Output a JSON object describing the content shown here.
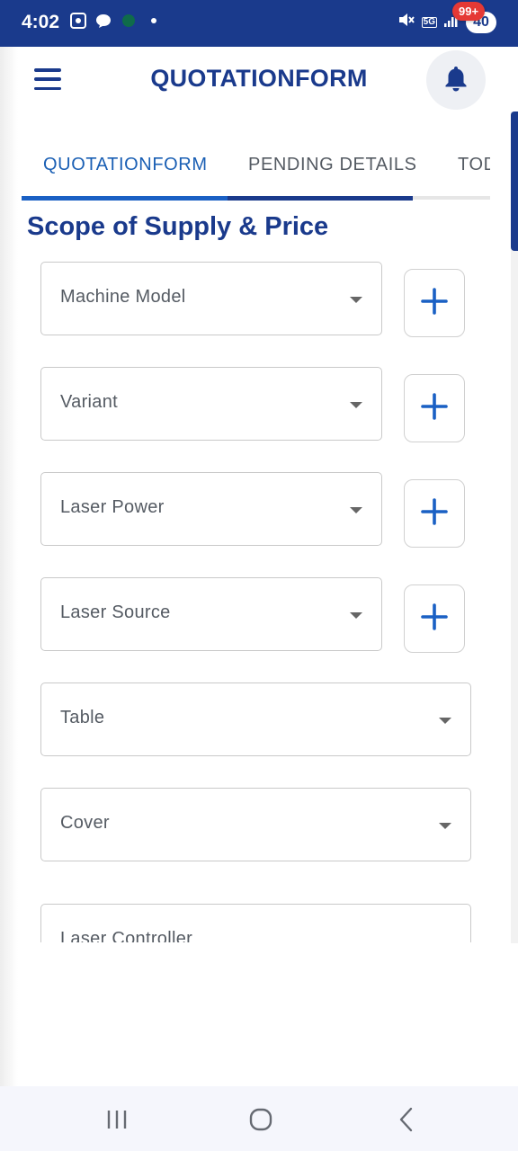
{
  "status_bar": {
    "time": "4:02",
    "network": "5G",
    "battery": "40"
  },
  "header": {
    "title": "QUOTATIONFORM",
    "notification_badge": "99+"
  },
  "tabs": [
    {
      "label": "QUOTATIONFORM",
      "active": true
    },
    {
      "label": "PENDING DETAILS",
      "active": false
    },
    {
      "label": "TOD",
      "active": false
    }
  ],
  "section": {
    "title": "Scope of Supply & Price"
  },
  "fields": [
    {
      "label": "Machine Model",
      "has_add": true
    },
    {
      "label": "Variant",
      "has_add": true
    },
    {
      "label": "Laser Power",
      "has_add": true
    },
    {
      "label": "Laser Source",
      "has_add": true
    },
    {
      "label": "Table",
      "has_add": false
    },
    {
      "label": "Cover",
      "has_add": false
    },
    {
      "label": "Laser Controller",
      "has_add": false
    }
  ],
  "colors": {
    "primary": "#1a3a8c",
    "accent": "#1a60c4",
    "badge": "#e53935",
    "text_muted": "#555b63"
  },
  "icons": {
    "menu": "hamburger-menu-icon",
    "bell": "bell-icon",
    "add": "plus-icon",
    "dropdown": "caret-down-icon"
  }
}
